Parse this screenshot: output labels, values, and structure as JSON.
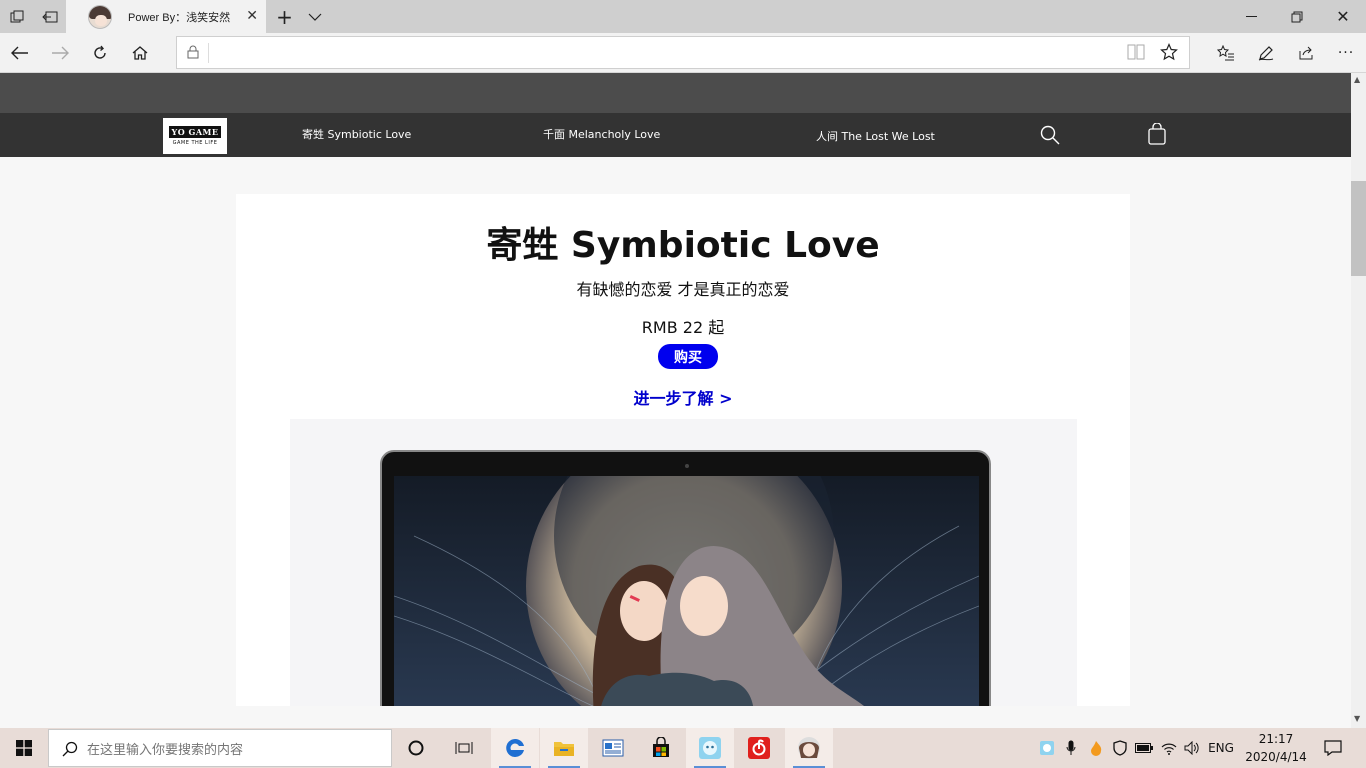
{
  "browser": {
    "tab_title": "Power By：浅笑安然",
    "url_value": ""
  },
  "site_nav": {
    "logo_line1": "YO GAME",
    "logo_line2": "GAME THE LIFE",
    "links": [
      "寄甡 Symbiotic Love",
      "千面 Melancholy Love",
      "人间 The Lost We Lost"
    ]
  },
  "product": {
    "title": "寄甡 Symbiotic Love",
    "subtitle": "有缺憾的恋爱 才是真正的恋爱",
    "price": "RMB 22 起",
    "buy_label": "购买",
    "learn_more": "进一步了解 >"
  },
  "taskbar": {
    "search_placeholder": "在这里输入你要搜索的内容",
    "lang": "ENG",
    "time": "21:17",
    "date": "2020/4/14"
  },
  "colors": {
    "nav_bg": "#333333",
    "top_strip": "#4c4c4c",
    "buy_button": "#0000ee",
    "learn_more": "#0000cc",
    "taskbar": "#e8dcd7"
  }
}
